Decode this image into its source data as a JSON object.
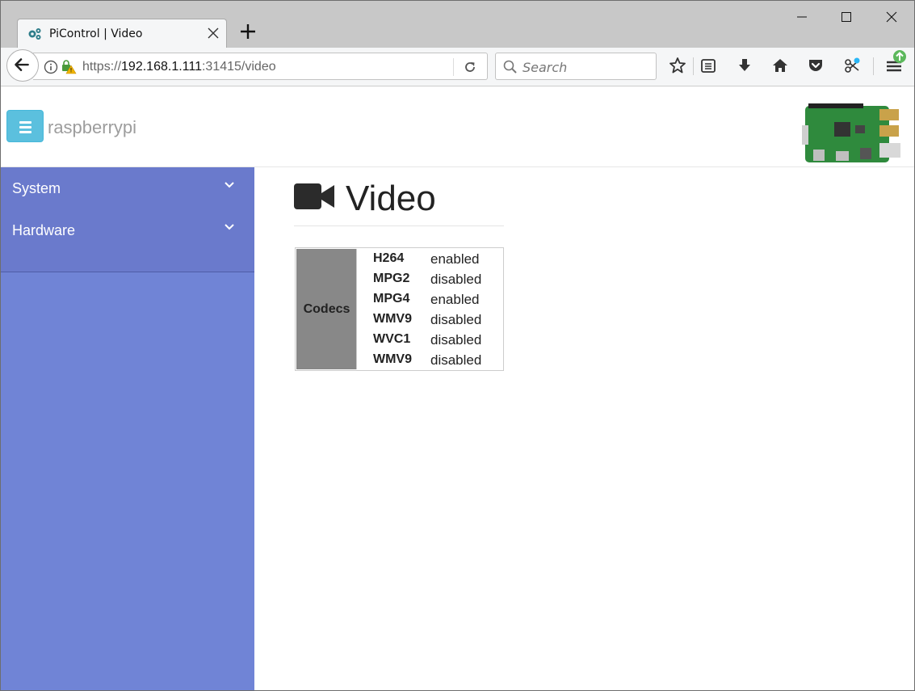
{
  "browser": {
    "tab_title": "PiControl | Video",
    "url_scheme": "https://",
    "url_host": "192.168.1.111",
    "url_rest": ":31415/video",
    "search_placeholder": "Search"
  },
  "header": {
    "brand": "raspberrypi"
  },
  "sidebar": {
    "items": [
      {
        "label": "System"
      },
      {
        "label": "Hardware"
      }
    ]
  },
  "main": {
    "title": "Video",
    "table": {
      "header": "Codecs",
      "rows": [
        {
          "name": "H264",
          "status": "enabled"
        },
        {
          "name": "MPG2",
          "status": "disabled"
        },
        {
          "name": "MPG4",
          "status": "enabled"
        },
        {
          "name": "WMV9",
          "status": "disabled"
        },
        {
          "name": "WVC1",
          "status": "disabled"
        },
        {
          "name": "WMV9",
          "status": "disabled"
        }
      ]
    }
  },
  "colors": {
    "sidebar": "#7084d6",
    "sidebar_item": "#6a7acc",
    "toggle_button": "#5bc0de",
    "codec_header": "#888888"
  }
}
